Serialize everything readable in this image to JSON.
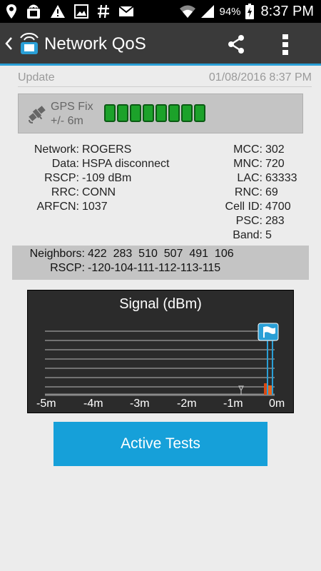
{
  "status_bar": {
    "icons": [
      "location-pin-icon",
      "app-notification-icon",
      "warning-icon",
      "image-icon",
      "hash-icon",
      "mail-icon"
    ],
    "battery_percent": "94%",
    "time": "8:37 PM"
  },
  "action_bar": {
    "title": "Network QoS",
    "back_icon": "chevron-left-icon",
    "logo_icon": "app-logo-icon",
    "share_icon": "share-icon",
    "menu_icon": "overflow-menu-icon"
  },
  "update": {
    "label": "Update",
    "timestamp": "01/08/2016  8:37 PM"
  },
  "gps": {
    "line1": "GPS Fix",
    "line2": "+/- 6m",
    "bars": 8,
    "bar_color": "#1ca22a"
  },
  "network_info_left": [
    {
      "label": "Network:",
      "value": "ROGERS"
    },
    {
      "label": "Data:",
      "value": "HSPA disconnect"
    },
    {
      "label": "RSCP:",
      "value": "-109 dBm"
    },
    {
      "label": "RRC:",
      "value": "CONN"
    },
    {
      "label": "ARFCN:",
      "value": "1037"
    }
  ],
  "network_info_right": [
    {
      "label": "MCC:",
      "value": "302"
    },
    {
      "label": "MNC:",
      "value": "720"
    },
    {
      "label": "LAC:",
      "value": "63333"
    },
    {
      "label": "RNC:",
      "value": "69"
    },
    {
      "label": "Cell ID:",
      "value": "4700"
    },
    {
      "label": "PSC:",
      "value": "283"
    },
    {
      "label": "Band:",
      "value": "5"
    }
  ],
  "neighbors": {
    "label": "Neighbors:",
    "values": "422  283  510  507  491  106",
    "rscp_label": "RSCP:",
    "rscp_values": "-120-104-111-112-113-115"
  },
  "signal_chart": {
    "title": "Signal (dBm)",
    "x_ticks": [
      "-5m",
      "-4m",
      "-3m",
      "-2m",
      "-1m",
      "0m"
    ],
    "flag_icon": "flag-icon",
    "accent_color": "#2a9fd6",
    "bar_color": "#e8641c"
  },
  "active_tests_button": "Active Tests"
}
